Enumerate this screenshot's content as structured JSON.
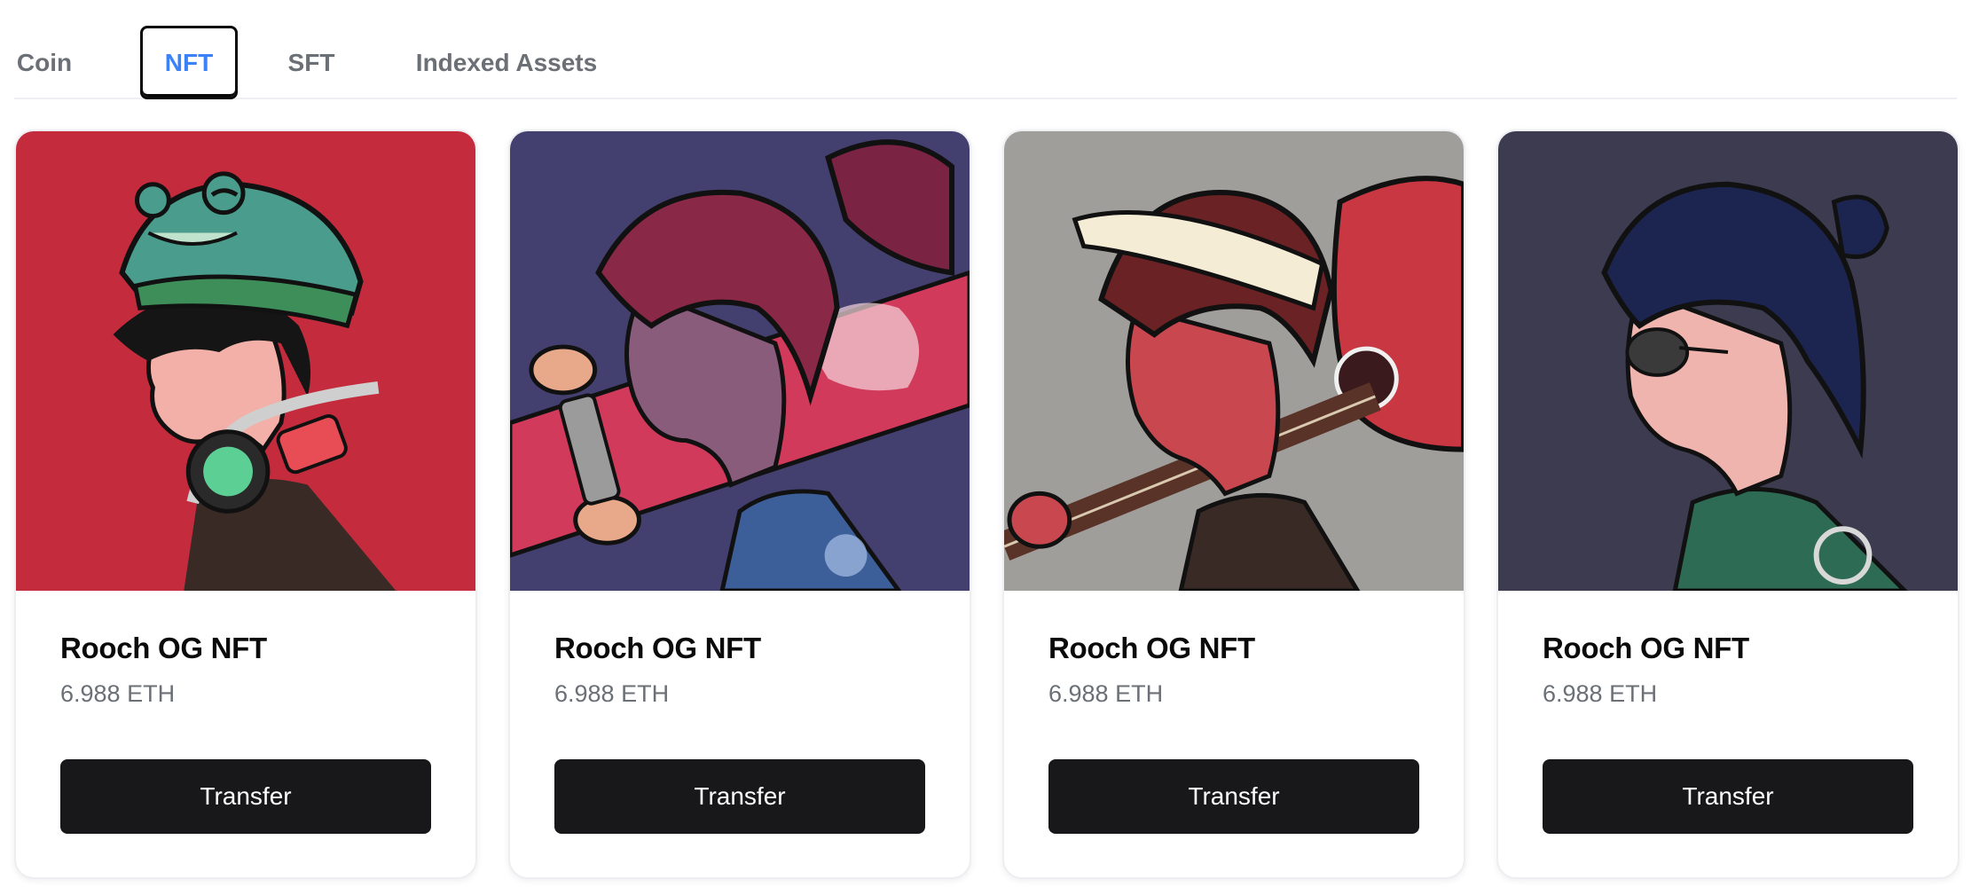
{
  "tabs": [
    {
      "label": "Coin",
      "active": false
    },
    {
      "label": "NFT",
      "active": true
    },
    {
      "label": "SFT",
      "active": false
    },
    {
      "label": "Indexed Assets",
      "active": false
    }
  ],
  "nfts": [
    {
      "title": "Rooch OG NFT",
      "price": "6.988 ETH",
      "button_label": "Transfer",
      "image_icon": "anime-boy-frog-hat-image",
      "bg_color": "#c42c3e"
    },
    {
      "title": "Rooch OG NFT",
      "price": "6.988 ETH",
      "button_label": "Transfer",
      "image_icon": "anime-girl-skateboard-image",
      "bg_color": "#433f6e"
    },
    {
      "title": "Rooch OG NFT",
      "price": "6.988 ETH",
      "button_label": "Transfer",
      "image_icon": "anime-boy-guitar-image",
      "bg_color": "#a09e9a"
    },
    {
      "title": "Rooch OG NFT",
      "price": "6.988 ETH",
      "button_label": "Transfer",
      "image_icon": "anime-boy-eyepatch-image",
      "bg_color": "#3d3b50"
    }
  ],
  "colors": {
    "accent": "#3b82f6",
    "button_bg": "#18181b",
    "muted_text": "#6b6f76"
  }
}
